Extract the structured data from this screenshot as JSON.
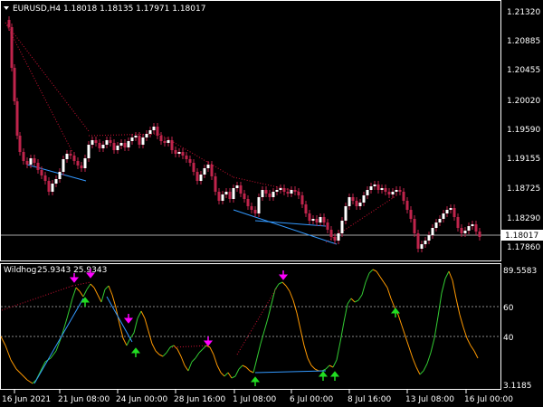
{
  "main_chart": {
    "symbol_label": "EURUSD,H4",
    "ohlc_label": "1.18018 1.18135 1.17971 1.18017",
    "current_price_label": "1.18017",
    "price_ticks": [
      "1.21320",
      "1.20885",
      "1.20455",
      "1.20020",
      "1.19590",
      "1.19155",
      "1.18725",
      "1.18290",
      "1.17860"
    ]
  },
  "indicator": {
    "name_label": "Wildhog",
    "values_label": "25.9343 25.9343",
    "level_ticks": [
      "89.5583",
      "60",
      "40",
      "3.1185"
    ]
  },
  "time_axis": {
    "labels": [
      "16 Jun 2021",
      "21 Jun 08:00",
      "24 Jun 00:00",
      "28 Jun 16:00",
      "1 Jul 08:00",
      "6 Jul 00:00",
      "8 Jul 16:00",
      "13 Jul 08:00",
      "16 Jul 00:00"
    ]
  },
  "colors": {
    "background": "#000000",
    "bull_candle": "#ffffff",
    "bear_candle": "#c0244c",
    "wick": "#c0244c",
    "up_line": "#33cc33",
    "down_line": "#ff9900",
    "buy_arrow": "#22dd22",
    "sell_arrow": "#ff00ff",
    "divergence_blue": "#3399ff",
    "divergence_red": "#cc1133",
    "grid": "#888888"
  }
}
